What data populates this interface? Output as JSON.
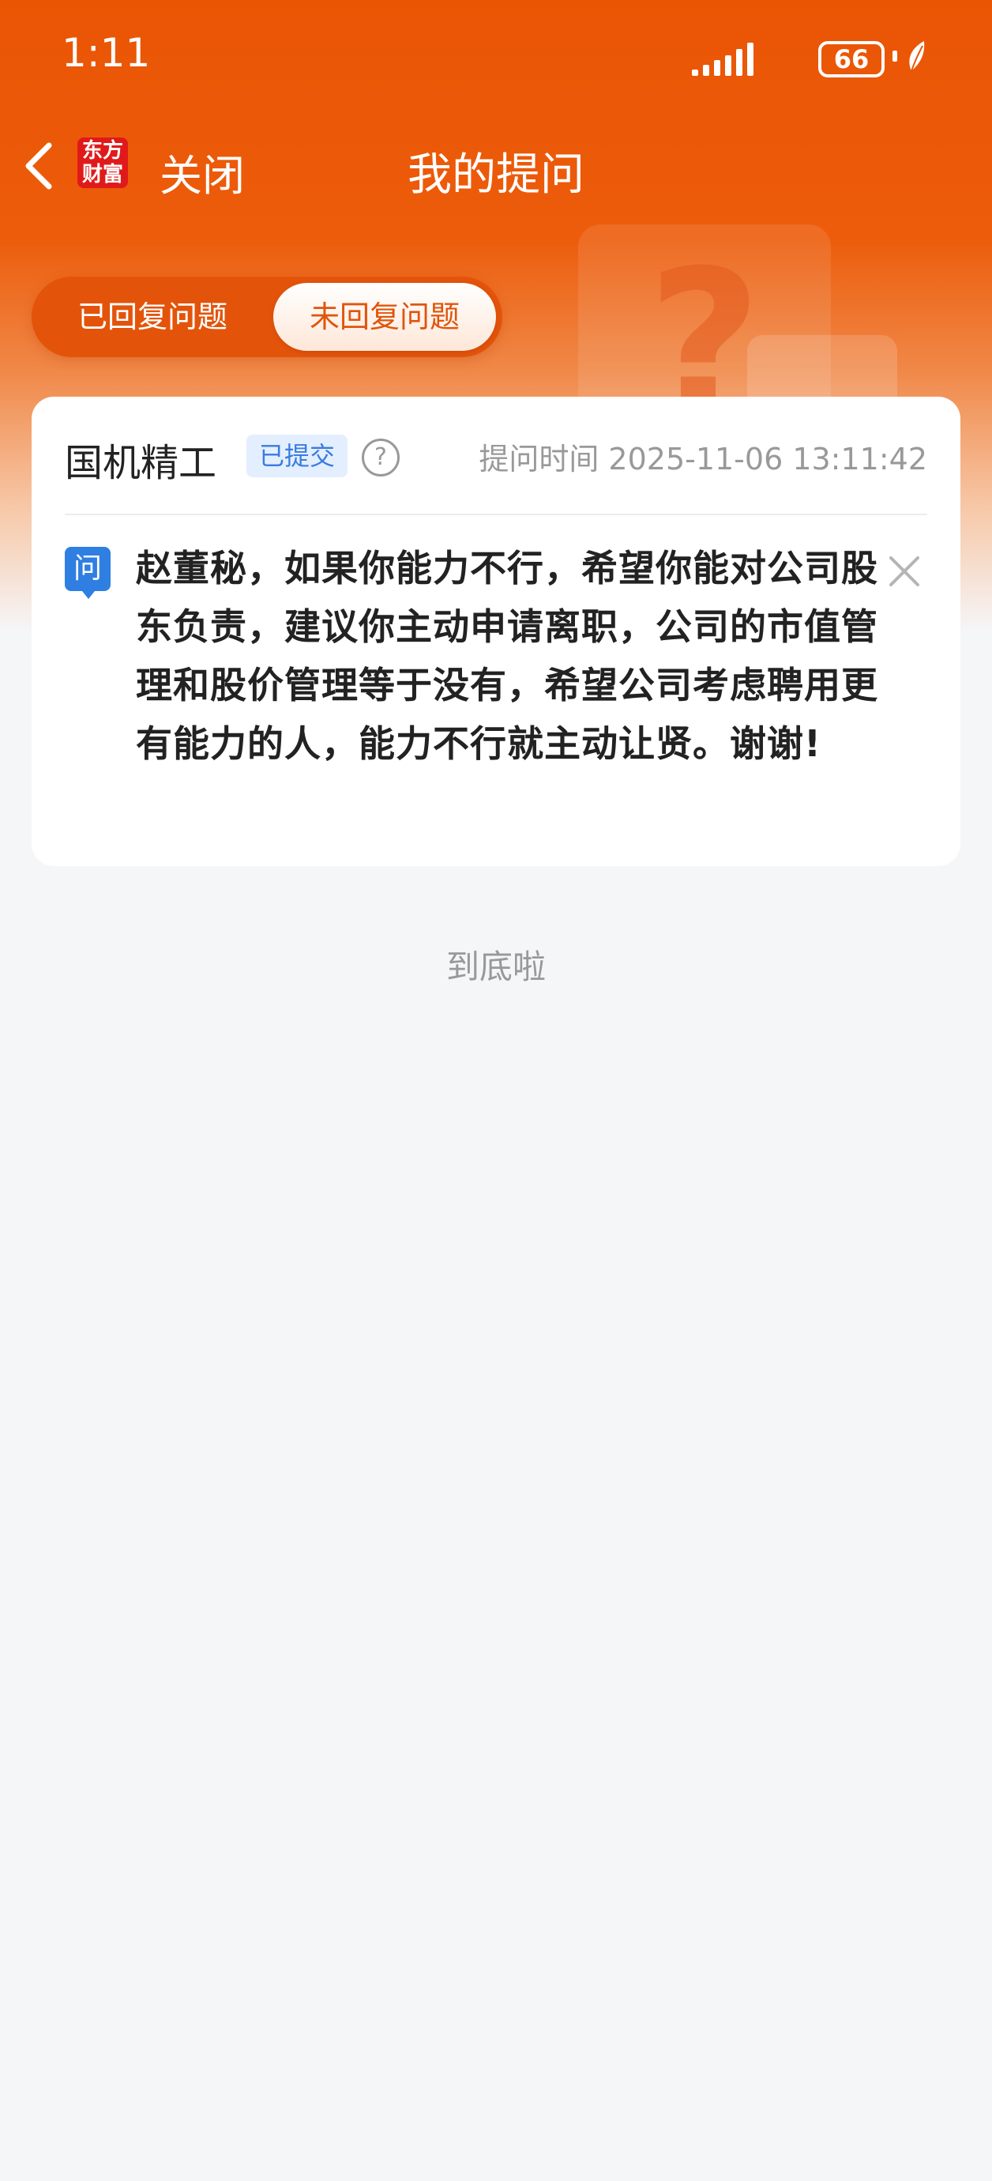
{
  "status_bar": {
    "time": "1:11",
    "battery": "66",
    "icons": [
      "signal-icon",
      "battery-icon",
      "leaf-icon"
    ]
  },
  "nav": {
    "back_icon": "chevron-left-icon",
    "logo_text_line1": "东方",
    "logo_text_line2": "财富",
    "close_label": "关闭",
    "title": "我的提问"
  },
  "tabs": {
    "items": [
      {
        "label": "已回复问题",
        "selected": false
      },
      {
        "label": "未回复问题",
        "selected": true
      }
    ]
  },
  "question_card": {
    "company": "国机精工",
    "status_badge": "已提交",
    "help_icon": "question-circle-icon",
    "time_label": "提问时间 2025-11-06 13:11:42",
    "question_icon_label": "问",
    "question_text": "赵董秘，如果你能力不行，希望你能对公司股东负责，建议你主动申请离职，公司的市值管理和股价管理等于没有，希望公司考虑聘用更有能力的人，能力不行就主动让贤。谢谢!",
    "delete_icon": "close-icon"
  },
  "footer": {
    "end_text": "到底啦"
  },
  "colors": {
    "brand": "#ea5504",
    "badge_bg": "#e3efff",
    "badge_text": "#3a7be0",
    "question_icon": "#2f7fe2"
  }
}
